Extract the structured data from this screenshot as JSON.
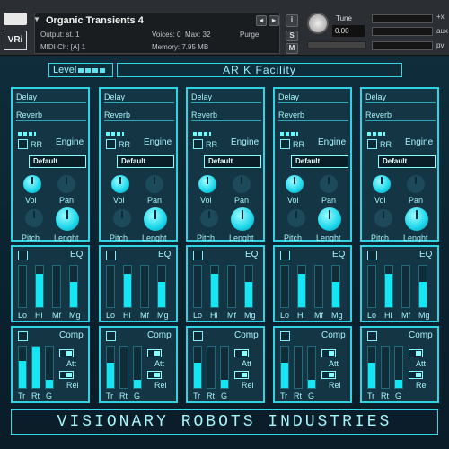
{
  "header": {
    "title": "Organic Transients 4",
    "output_label": "Output:",
    "output_value": "st. 1",
    "voices_label": "Voices:",
    "voices_value": "0",
    "max_label": "Max:",
    "max_value": "32",
    "purge_label": "Purge",
    "midi_label": "MIDI Ch:",
    "midi_value": "[A]  1",
    "memory_label": "Memory:",
    "memory_value": "7.95 MB",
    "s_label": "S",
    "m_label": "M",
    "info_label": "i",
    "tune_label": "Tune",
    "tune_value": "0.00",
    "logo": "VRi",
    "side_top": "+x",
    "side_mid": "aux",
    "side_bot": "pv"
  },
  "instrument": {
    "level_label": "Level",
    "name": "AR K Facility",
    "footer": "Visionary Robots Industries",
    "accent_color": "#2fd3e4",
    "modules": [
      {
        "delay": "Delay",
        "reverb": "Reverb",
        "rr": "RR",
        "engine": "Engine",
        "preset": "Default",
        "vol": "Vol",
        "pan": "Pan",
        "pitch": "Pitch",
        "length": "Lenght",
        "eq": "EQ",
        "lo": "Lo",
        "hi": "Hi",
        "mf": "Mf",
        "mg": "Mg",
        "comp": "Comp",
        "att": "Att",
        "rel": "Rel",
        "tr": "Tr",
        "rt": "Rt",
        "g": "G",
        "eq_levels": [
          0.0,
          0.8,
          0.0,
          0.6
        ],
        "comp_levels": [
          0.65,
          1.0,
          0.2
        ]
      },
      {
        "delay": "Delay",
        "reverb": "Reverb",
        "rr": "RR",
        "engine": "Engine",
        "preset": "Default",
        "vol": "Vol",
        "pan": "Pan",
        "pitch": "Pitch",
        "length": "Lenght",
        "eq": "EQ",
        "lo": "Lo",
        "hi": "Hi",
        "mf": "Mf",
        "mg": "Mg",
        "comp": "Comp",
        "att": "Att",
        "rel": "Rel",
        "tr": "Tr",
        "rt": "Rt",
        "g": "G",
        "eq_levels": [
          0.0,
          0.8,
          0.0,
          0.6
        ],
        "comp_levels": [
          0.6,
          0.0,
          0.2
        ]
      },
      {
        "delay": "Delay",
        "reverb": "Reverb",
        "rr": "RR",
        "engine": "Engine",
        "preset": "Default",
        "vol": "Vol",
        "pan": "Pan",
        "pitch": "Pitch",
        "length": "Lenght",
        "eq": "EQ",
        "lo": "Lo",
        "hi": "Hi",
        "mf": "Mf",
        "mg": "Mg",
        "comp": "Comp",
        "att": "Att",
        "rel": "Rel",
        "tr": "Tr",
        "rt": "Rt",
        "g": "G",
        "eq_levels": [
          0.0,
          0.8,
          0.0,
          0.6
        ],
        "comp_levels": [
          0.6,
          0.0,
          0.2
        ]
      },
      {
        "delay": "Delay",
        "reverb": "Reverb",
        "rr": "RR",
        "engine": "Engine",
        "preset": "Default",
        "vol": "Vol",
        "pan": "Pan",
        "pitch": "Pitch",
        "length": "Lenght",
        "eq": "EQ",
        "lo": "Lo",
        "hi": "Hi",
        "mf": "Mf",
        "mg": "Mg",
        "comp": "Comp",
        "att": "Att",
        "rel": "Rel",
        "tr": "Tr",
        "rt": "Rt",
        "g": "G",
        "eq_levels": [
          0.0,
          0.8,
          0.0,
          0.6
        ],
        "comp_levels": [
          0.6,
          0.0,
          0.2
        ]
      },
      {
        "delay": "Delay",
        "reverb": "Reverb",
        "rr": "RR",
        "engine": "Engine",
        "preset": "Default",
        "vol": "Vol",
        "pan": "Pan",
        "pitch": "Pitch",
        "length": "Lenght",
        "eq": "EQ",
        "lo": "Lo",
        "hi": "Hi",
        "mf": "Mf",
        "mg": "Mg",
        "comp": "Comp",
        "att": "Att",
        "rel": "Rel",
        "tr": "Tr",
        "rt": "Rt",
        "g": "G",
        "eq_levels": [
          0.0,
          0.8,
          0.0,
          0.6
        ],
        "comp_levels": [
          0.6,
          0.0,
          0.2
        ]
      }
    ]
  }
}
